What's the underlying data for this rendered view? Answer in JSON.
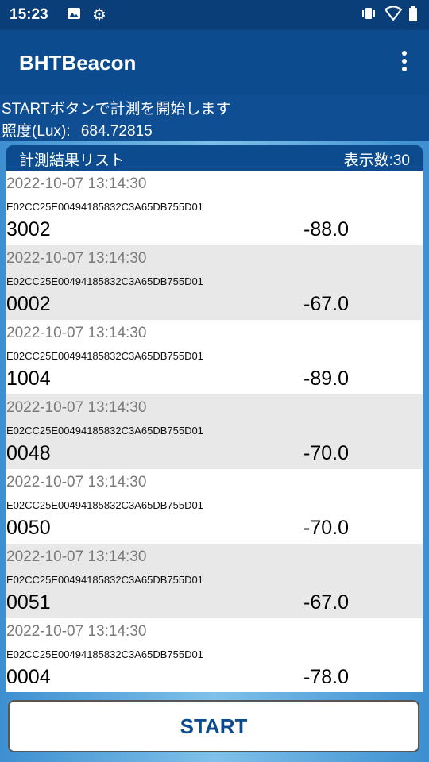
{
  "status": {
    "time": "15:23",
    "icons": [
      "image-icon",
      "gear-icon",
      "vibrate-icon",
      "wifi-icon",
      "battery-icon"
    ]
  },
  "app": {
    "title": "BHTBeacon"
  },
  "info": {
    "message": "STARTボタンで計測を開始します",
    "lux_label": "照度(Lux):",
    "lux_value": "684.72815"
  },
  "list": {
    "title": "計測結果リスト",
    "count_label": "表示数:30",
    "rows": [
      {
        "date": "2022-10-07 13:14:30",
        "uuid": "E02CC25E00494185832C3A65DB755D01",
        "id": "3002",
        "rssi": "-88.0"
      },
      {
        "date": "2022-10-07 13:14:30",
        "uuid": "E02CC25E00494185832C3A65DB755D01",
        "id": "0002",
        "rssi": "-67.0"
      },
      {
        "date": "2022-10-07 13:14:30",
        "uuid": "E02CC25E00494185832C3A65DB755D01",
        "id": "1004",
        "rssi": "-89.0"
      },
      {
        "date": "2022-10-07 13:14:30",
        "uuid": "E02CC25E00494185832C3A65DB755D01",
        "id": "0048",
        "rssi": "-70.0"
      },
      {
        "date": "2022-10-07 13:14:30",
        "uuid": "E02CC25E00494185832C3A65DB755D01",
        "id": "0050",
        "rssi": "-70.0"
      },
      {
        "date": "2022-10-07 13:14:30",
        "uuid": "E02CC25E00494185832C3A65DB755D01",
        "id": "0051",
        "rssi": "-67.0"
      },
      {
        "date": "2022-10-07 13:14:30",
        "uuid": "E02CC25E00494185832C3A65DB755D01",
        "id": "0004",
        "rssi": "-78.0"
      }
    ]
  },
  "start_button": "START",
  "colors": {
    "primary": "#0b4b8e",
    "status_bar": "#0a3e78",
    "row_alt": "#e8e8e8"
  }
}
